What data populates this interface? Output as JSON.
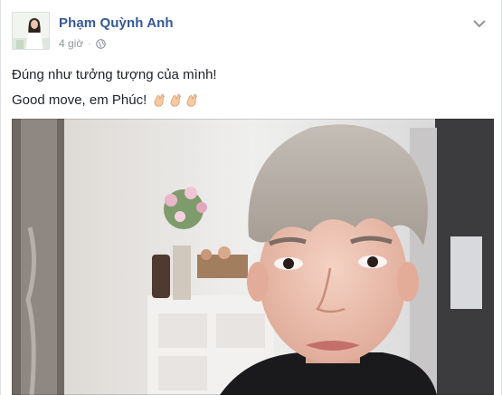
{
  "post": {
    "author": "Phạm Quỳnh Anh",
    "time": "4 giờ",
    "separator": "·",
    "privacy_icon": "globe-icon",
    "menu_icon": "chevron-down-icon",
    "text_line_1": "Đúng như tưởng tượng của mình!",
    "text_line_2": "Good move, em Phúc!",
    "emoji": [
      "clapping-hands-icon",
      "clapping-hands-icon",
      "clapping-hands-icon"
    ],
    "media_type": "video-frame"
  },
  "colors": {
    "author_link": "#365899",
    "meta_text": "#90949c",
    "body_text": "#1d2129",
    "border": "#dddfe2"
  }
}
